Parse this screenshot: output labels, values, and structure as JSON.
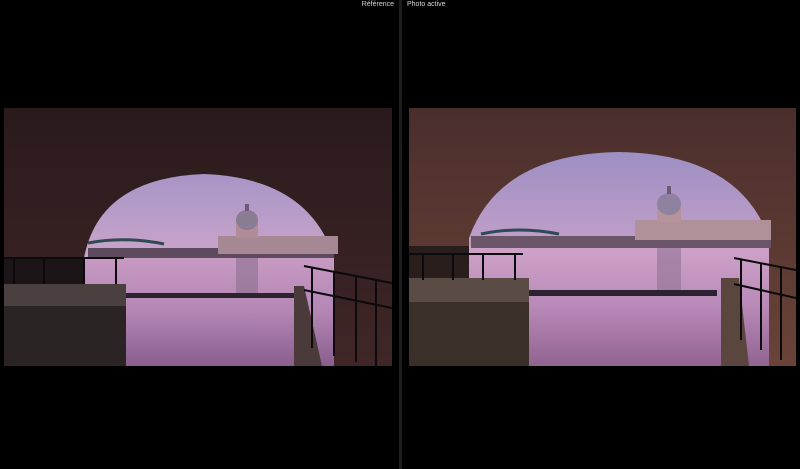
{
  "panes": {
    "reference": {
      "label": "Référence"
    },
    "active": {
      "label": "Photo active"
    }
  },
  "colors": {
    "background": "#000000",
    "divider": "#1d1d1d",
    "label": "#d6d6d6",
    "sky_top": "#b9a6cd",
    "sky_bottom": "#e9b7cc",
    "water": "#c493bc",
    "bridge_stone": "#3a2424"
  }
}
